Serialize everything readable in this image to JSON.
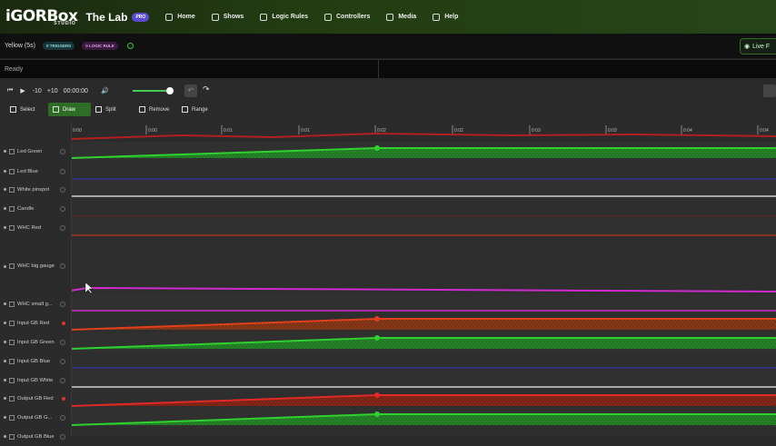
{
  "nav": {
    "logo": "iGORBox",
    "logo_sub": "STUDIO",
    "project": "The Lab",
    "pro_badge": "PRO",
    "items": [
      "Home",
      "Shows",
      "Logic Rules",
      "Controllers",
      "Media",
      "Help"
    ]
  },
  "cue": {
    "name": "Yellow (5s)",
    "triggers": "0 TRIGGERS",
    "logic": "0 LOGIC RULE",
    "live_label": "Live F"
  },
  "status": {
    "text": "Ready"
  },
  "transport": {
    "minus10": "-10",
    "plus10": "+10",
    "time": "00:00:00"
  },
  "tools": [
    "Select",
    "Draw",
    "Split",
    "Remove",
    "Range"
  ],
  "ruler": [
    "0:00",
    "0:00",
    "0:01",
    "0:01",
    "0:02",
    "0:02",
    "0:03",
    "0:03",
    "0:04",
    "0:04"
  ],
  "tracks": [
    {
      "label": "Led Green"
    },
    {
      "label": "Led Blue"
    },
    {
      "label": "White pinspot"
    },
    {
      "label": "Candle"
    },
    {
      "label": "WHC Red"
    },
    {
      "label": "WHC big gauge"
    },
    {
      "label": "WHC small g..."
    },
    {
      "label": "Input GB  Red"
    },
    {
      "label": "Input GB Green"
    },
    {
      "label": "Input GB Blue"
    },
    {
      "label": "Input GB White"
    },
    {
      "label": "Output GB Red"
    },
    {
      "label": "Output GB G..."
    },
    {
      "label": "Output GB Blue"
    }
  ],
  "colors": {
    "accent": "#2d6d25",
    "green": "#2fc22f",
    "red": "#c0321c",
    "blue": "#3030a8",
    "magenta": "#d02ad0"
  }
}
